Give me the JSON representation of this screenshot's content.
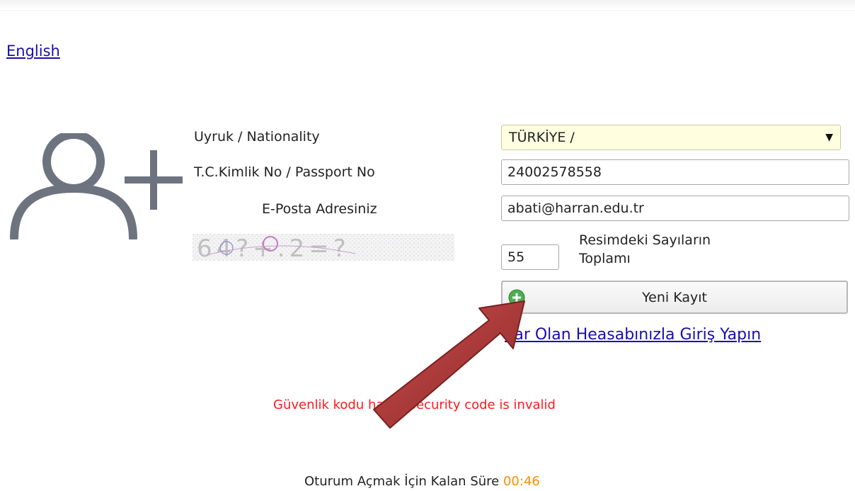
{
  "header": {
    "language_link": "English"
  },
  "form": {
    "nationality": {
      "label": "Uyruk / Nationality",
      "selected": "TÜRKİYE /"
    },
    "id_number": {
      "label": "T.C.Kimlik No / Passport No",
      "value": "24002578558"
    },
    "email": {
      "label": "E-Posta Adresiniz",
      "value": "abati@harran.edu.tr"
    },
    "captcha": {
      "image_text": "64?+.2=?",
      "answer": "55",
      "label_line1": "Resimdeki Sayıların",
      "label_line2": "Toplamı"
    },
    "submit_label": "Yeni Kayıt",
    "login_link": "Var Olan Heasabınızla Giriş Yapın"
  },
  "messages": {
    "error": "Güvenlik kodu hatalı/Security code is invalid",
    "timer_label": "Oturum Açmak İçin Kalan Süre",
    "timer_value": "00:46"
  },
  "icons": {
    "user_add": "user-plus-icon",
    "button_icon": "green-plus-circle-icon",
    "dropdown": "triangle-down-icon"
  },
  "colors": {
    "link": "#1a0dab",
    "error": "#ff1a1a",
    "timer": "#ff8c00",
    "select_bg": "#ffffe0",
    "arrow": "#b23b3b"
  }
}
